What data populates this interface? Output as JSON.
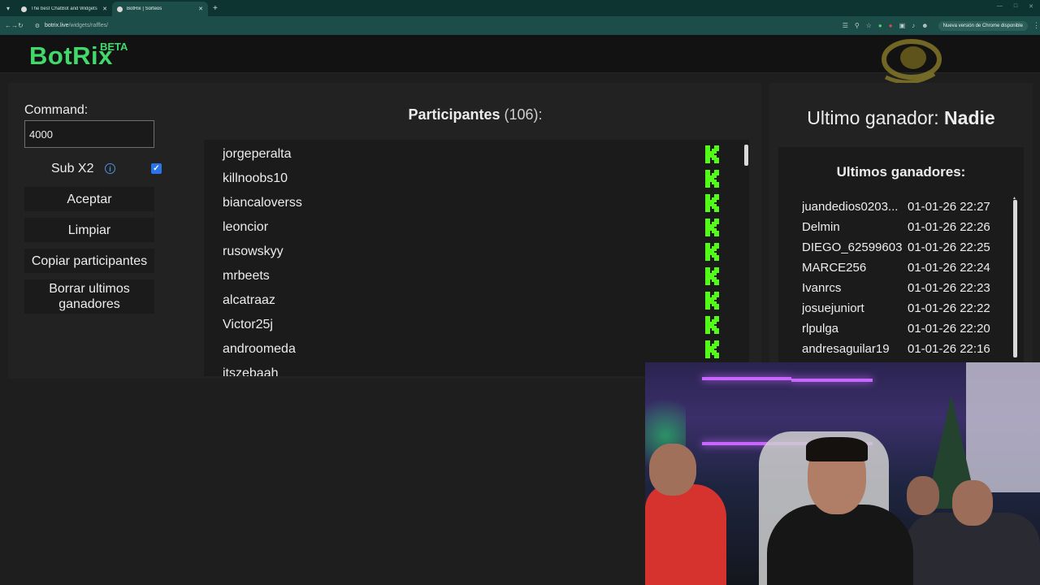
{
  "browser": {
    "tabs": [
      {
        "title": "The best ChatBot and Widgets",
        "active": false
      },
      {
        "title": "BotRix | Sorteos",
        "active": true
      }
    ],
    "url_host": "botrix.live",
    "url_path": "/widgets/raffles/",
    "update_label": "Nueva versión de Chrome disponible"
  },
  "site": {
    "logo": "BotRix",
    "badge": "BETA",
    "brand_color": "#42d96b"
  },
  "controls": {
    "command_label": "Command:",
    "command_value": "4000",
    "sub_x2_label": "Sub X2",
    "sub_x2_checked": true,
    "accept_label": "Aceptar",
    "clear_label": "Limpiar",
    "copy_label": "Copiar participantes",
    "delete_label": "Borrar ultimos ganadores"
  },
  "participants": {
    "title": "Participantes",
    "count": "(106):",
    "items": [
      "jorgeperalta",
      "killnoobs10",
      "biancaloverss",
      "leoncior",
      "rusowskyy",
      "mrbeets",
      "alcatraaz",
      "Victor25j",
      "androomeda",
      "itszebaah"
    ]
  },
  "last_winner": {
    "label": "Ultimo ganador:",
    "name": "Nadie"
  },
  "winners": {
    "title": "Ultimos ganadores:",
    "items": [
      {
        "name": "juandedios0203...",
        "time": "01-01-26 22:27"
      },
      {
        "name": "Delmin",
        "time": "01-01-26 22:26"
      },
      {
        "name": "DIEGO_62599603",
        "time": "01-01-26 22:25"
      },
      {
        "name": "MARCE256",
        "time": "01-01-26 22:24"
      },
      {
        "name": "Ivanrcs",
        "time": "01-01-26 22:23"
      },
      {
        "name": "josuejuniort",
        "time": "01-01-26 22:22"
      },
      {
        "name": "rlpulga",
        "time": "01-01-26 22:20"
      },
      {
        "name": "andresaguilar19",
        "time": "01-01-26 22:16"
      }
    ]
  },
  "icons": {
    "platform": "kick-icon",
    "info": "info-icon"
  }
}
